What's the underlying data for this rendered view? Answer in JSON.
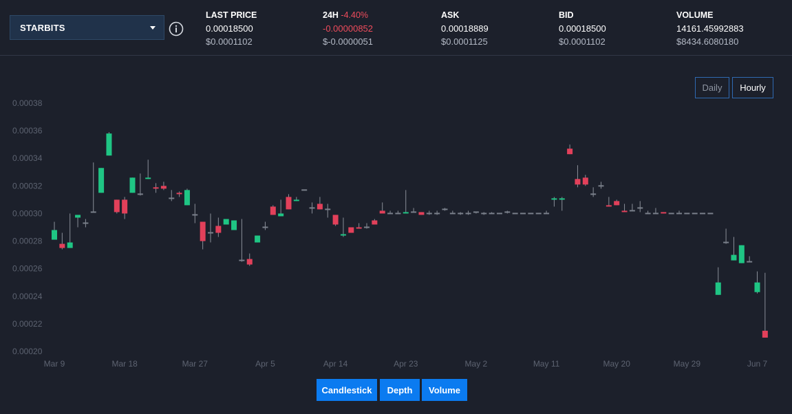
{
  "market": {
    "name": "STARBITS"
  },
  "stats": {
    "last_price": {
      "title": "LAST PRICE",
      "value": "0.00018500",
      "usd": "$0.0001102"
    },
    "change_24h": {
      "title": "24H",
      "percent": "-4.40%",
      "value": "-0.00000852",
      "usd": "$-0.0000051"
    },
    "ask": {
      "title": "ASK",
      "value": "0.00018889",
      "usd": "$0.0001125"
    },
    "bid": {
      "title": "BID",
      "value": "0.00018500",
      "usd": "$0.0001102"
    },
    "volume": {
      "title": "VOLUME",
      "value": "14161.45992883",
      "usd": "$8434.6080180"
    }
  },
  "timeframe": {
    "daily": "Daily",
    "hourly": "Hourly",
    "selected": "Hourly"
  },
  "views": {
    "candlestick": "Candlestick",
    "depth": "Depth",
    "volume": "Volume"
  },
  "colors": {
    "up": "#1fc584",
    "down": "#e2405a",
    "wick": "#8a8f99",
    "grid_text": "#5d6371"
  },
  "chart_data": {
    "type": "candlestick",
    "ylim": [
      0.0002,
      0.00038
    ],
    "y_ticks": [
      "0.00020",
      "0.00022",
      "0.00024",
      "0.00026",
      "0.00028",
      "0.00030",
      "0.00032",
      "0.00034",
      "0.00036",
      "0.00038"
    ],
    "x_ticks": [
      {
        "label": "Mar 9",
        "index": 0
      },
      {
        "label": "Mar 18",
        "index": 9
      },
      {
        "label": "Mar 27",
        "index": 18
      },
      {
        "label": "Apr 5",
        "index": 27
      },
      {
        "label": "Apr 14",
        "index": 36
      },
      {
        "label": "Apr 23",
        "index": 45
      },
      {
        "label": "May 2",
        "index": 54
      },
      {
        "label": "May 11",
        "index": 63
      },
      {
        "label": "May 20",
        "index": 72
      },
      {
        "label": "May 29",
        "index": 81
      },
      {
        "label": "Jun 7",
        "index": 90
      }
    ],
    "grid": false,
    "candles": [
      {
        "o": 0.000281,
        "h": 0.000294,
        "l": 0.000281,
        "c": 0.000288
      },
      {
        "o": 0.000278,
        "h": 0.000286,
        "l": 0.000274,
        "c": 0.000275
      },
      {
        "o": 0.000275,
        "h": 0.0003,
        "l": 0.000275,
        "c": 0.000279
      },
      {
        "o": 0.000297,
        "h": 0.000298,
        "l": 0.00029,
        "c": 0.000299
      },
      {
        "o": 0.000293,
        "h": 0.000296,
        "l": 0.00029,
        "c": 0.000293
      },
      {
        "o": 0.000301,
        "h": 0.000337,
        "l": 0.000301,
        "c": 0.000301
      },
      {
        "o": 0.000315,
        "h": 0.000333,
        "l": 0.000315,
        "c": 0.000333
      },
      {
        "o": 0.000342,
        "h": 0.000359,
        "l": 0.000342,
        "c": 0.000358
      },
      {
        "o": 0.00031,
        "h": 0.00031,
        "l": 0.0003,
        "c": 0.000301
      },
      {
        "o": 0.00031,
        "h": 0.000312,
        "l": 0.000296,
        "c": 0.0003
      },
      {
        "o": 0.000315,
        "h": 0.000326,
        "l": 0.000315,
        "c": 0.000326
      },
      {
        "o": 0.000314,
        "h": 0.000329,
        "l": 0.000313,
        "c": 0.000314
      },
      {
        "o": 0.000325,
        "h": 0.000339,
        "l": 0.000325,
        "c": 0.000326
      },
      {
        "o": 0.000319,
        "h": 0.000322,
        "l": 0.000315,
        "c": 0.000318
      },
      {
        "o": 0.00032,
        "h": 0.000323,
        "l": 0.000317,
        "c": 0.000318
      },
      {
        "o": 0.000311,
        "h": 0.000317,
        "l": 0.000309,
        "c": 0.000311
      },
      {
        "o": 0.000315,
        "h": 0.000316,
        "l": 0.000312,
        "c": 0.000314
      },
      {
        "o": 0.000306,
        "h": 0.000318,
        "l": 0.000306,
        "c": 0.000317
      },
      {
        "o": 0.000299,
        "h": 0.000307,
        "l": 0.000293,
        "c": 0.000299
      },
      {
        "o": 0.000294,
        "h": 0.000294,
        "l": 0.000274,
        "c": 0.00028
      },
      {
        "o": 0.000286,
        "h": 0.0003,
        "l": 0.000279,
        "c": 0.000286
      },
      {
        "o": 0.000291,
        "h": 0.000297,
        "l": 0.000283,
        "c": 0.000286
      },
      {
        "o": 0.000292,
        "h": 0.000296,
        "l": 0.000292,
        "c": 0.000296
      },
      {
        "o": 0.000288,
        "h": 0.000295,
        "l": 0.000288,
        "c": 0.000295
      },
      {
        "o": 0.000266,
        "h": 0.000296,
        "l": 0.000265,
        "c": 0.000266
      },
      {
        "o": 0.000267,
        "h": 0.000271,
        "l": 0.000262,
        "c": 0.000263
      },
      {
        "o": 0.000279,
        "h": 0.000284,
        "l": 0.000279,
        "c": 0.000284
      },
      {
        "o": 0.00029,
        "h": 0.000294,
        "l": 0.000288,
        "c": 0.00029
      },
      {
        "o": 0.000305,
        "h": 0.000306,
        "l": 0.000299,
        "c": 0.000299
      },
      {
        "o": 0.000298,
        "h": 0.00031,
        "l": 0.000298,
        "c": 0.0003
      },
      {
        "o": 0.000312,
        "h": 0.000314,
        "l": 0.000303,
        "c": 0.000303
      },
      {
        "o": 0.000309,
        "h": 0.000312,
        "l": 0.000309,
        "c": 0.00031
      },
      {
        "o": 0.000317,
        "h": 0.000317,
        "l": 0.000317,
        "c": 0.000317
      },
      {
        "o": 0.000304,
        "h": 0.000308,
        "l": 0.0003,
        "c": 0.000304
      },
      {
        "o": 0.000307,
        "h": 0.000312,
        "l": 0.000303,
        "c": 0.000303
      },
      {
        "o": 0.000303,
        "h": 0.000307,
        "l": 0.000297,
        "c": 0.000303
      },
      {
        "o": 0.000299,
        "h": 0.000299,
        "l": 0.000291,
        "c": 0.000292
      },
      {
        "o": 0.000284,
        "h": 0.000297,
        "l": 0.000283,
        "c": 0.000285
      },
      {
        "o": 0.00029,
        "h": 0.00029,
        "l": 0.000286,
        "c": 0.000286
      },
      {
        "o": 0.00029,
        "h": 0.000293,
        "l": 0.000289,
        "c": 0.000289
      },
      {
        "o": 0.00029,
        "h": 0.000293,
        "l": 0.000289,
        "c": 0.00029
      },
      {
        "o": 0.000295,
        "h": 0.000296,
        "l": 0.000292,
        "c": 0.000292
      },
      {
        "o": 0.000302,
        "h": 0.000308,
        "l": 0.000302,
        "c": 0.0003
      },
      {
        "o": 0.0003,
        "h": 0.000302,
        "l": 0.0003,
        "c": 0.0003
      },
      {
        "o": 0.0003,
        "h": 0.000302,
        "l": 0.0003,
        "c": 0.0003
      },
      {
        "o": 0.0003,
        "h": 0.000317,
        "l": 0.0003,
        "c": 0.000301
      },
      {
        "o": 0.000301,
        "h": 0.000304,
        "l": 0.000301,
        "c": 0.000301
      },
      {
        "o": 0.000301,
        "h": 0.000301,
        "l": 0.000299,
        "c": 0.000299
      },
      {
        "o": 0.0003,
        "h": 0.000302,
        "l": 0.000299,
        "c": 0.0003
      },
      {
        "o": 0.0003,
        "h": 0.000302,
        "l": 0.000299,
        "c": 0.0003
      },
      {
        "o": 0.000303,
        "h": 0.000304,
        "l": 0.000302,
        "c": 0.000303
      },
      {
        "o": 0.0003,
        "h": 0.000302,
        "l": 0.0003,
        "c": 0.0003
      },
      {
        "o": 0.0003,
        "h": 0.000301,
        "l": 0.000299,
        "c": 0.0003
      },
      {
        "o": 0.0003,
        "h": 0.000302,
        "l": 0.000299,
        "c": 0.0003
      },
      {
        "o": 0.000301,
        "h": 0.000301,
        "l": 0.0003,
        "c": 0.000301
      },
      {
        "o": 0.0003,
        "h": 0.000301,
        "l": 0.000299,
        "c": 0.0003
      },
      {
        "o": 0.0003,
        "h": 0.000301,
        "l": 0.0003,
        "c": 0.0003
      },
      {
        "o": 0.0003,
        "h": 0.0003,
        "l": 0.0003,
        "c": 0.0003
      },
      {
        "o": 0.000301,
        "h": 0.000302,
        "l": 0.0003,
        "c": 0.000301
      },
      {
        "o": 0.0003,
        "h": 0.0003,
        "l": 0.0003,
        "c": 0.0003
      },
      {
        "o": 0.0003,
        "h": 0.0003,
        "l": 0.0003,
        "c": 0.0003
      },
      {
        "o": 0.0003,
        "h": 0.0003,
        "l": 0.0003,
        "c": 0.0003
      },
      {
        "o": 0.0003,
        "h": 0.0003,
        "l": 0.0003,
        "c": 0.0003
      },
      {
        "o": 0.0003,
        "h": 0.000302,
        "l": 0.0003,
        "c": 0.0003
      },
      {
        "o": 0.00031,
        "h": 0.000312,
        "l": 0.000305,
        "c": 0.000311
      },
      {
        "o": 0.00031,
        "h": 0.000312,
        "l": 0.000302,
        "c": 0.000311
      },
      {
        "o": 0.000347,
        "h": 0.00035,
        "l": 0.000343,
        "c": 0.000343
      },
      {
        "o": 0.000325,
        "h": 0.000335,
        "l": 0.000319,
        "c": 0.000321
      },
      {
        "o": 0.000326,
        "h": 0.000328,
        "l": 0.00032,
        "c": 0.000321
      },
      {
        "o": 0.000314,
        "h": 0.000319,
        "l": 0.000312,
        "c": 0.000314
      },
      {
        "o": 0.00032,
        "h": 0.000323,
        "l": 0.000318,
        "c": 0.00032
      },
      {
        "o": 0.000306,
        "h": 0.000312,
        "l": 0.000305,
        "c": 0.000305
      },
      {
        "o": 0.000309,
        "h": 0.00031,
        "l": 0.000306,
        "c": 0.000306
      },
      {
        "o": 0.000302,
        "h": 0.000307,
        "l": 0.000301,
        "c": 0.000301
      },
      {
        "o": 0.000302,
        "h": 0.000307,
        "l": 0.000302,
        "c": 0.000302
      },
      {
        "o": 0.000304,
        "h": 0.000309,
        "l": 0.000301,
        "c": 0.000304
      },
      {
        "o": 0.0003,
        "h": 0.000302,
        "l": 0.0003,
        "c": 0.0003
      },
      {
        "o": 0.0003,
        "h": 0.000304,
        "l": 0.0003,
        "c": 0.0003
      },
      {
        "o": 0.000301,
        "h": 0.000301,
        "l": 0.0003,
        "c": 0.0003
      },
      {
        "o": 0.0003,
        "h": 0.0003,
        "l": 0.0003,
        "c": 0.0003
      },
      {
        "o": 0.0003,
        "h": 0.000302,
        "l": 0.0003,
        "c": 0.0003
      },
      {
        "o": 0.0003,
        "h": 0.0003,
        "l": 0.0003,
        "c": 0.0003
      },
      {
        "o": 0.0003,
        "h": 0.0003,
        "l": 0.0003,
        "c": 0.0003
      },
      {
        "o": 0.0003,
        "h": 0.0003,
        "l": 0.0003,
        "c": 0.0003
      },
      {
        "o": 0.0003,
        "h": 0.0003,
        "l": 0.0003,
        "c": 0.0003
      },
      {
        "o": 0.000241,
        "h": 0.000261,
        "l": 0.000241,
        "c": 0.00025
      },
      {
        "o": 0.000279,
        "h": 0.000289,
        "l": 0.000278,
        "c": 0.000279
      },
      {
        "o": 0.000266,
        "h": 0.000283,
        "l": 0.000266,
        "c": 0.00027
      },
      {
        "o": 0.000264,
        "h": 0.000277,
        "l": 0.000264,
        "c": 0.000277
      },
      {
        "o": 0.000265,
        "h": 0.000269,
        "l": 0.000265,
        "c": 0.000265
      },
      {
        "o": 0.000243,
        "h": 0.000258,
        "l": 0.000242,
        "c": 0.00025
      },
      {
        "o": 0.000215,
        "h": 0.000257,
        "l": 0.00021,
        "c": 0.00021
      }
    ]
  }
}
